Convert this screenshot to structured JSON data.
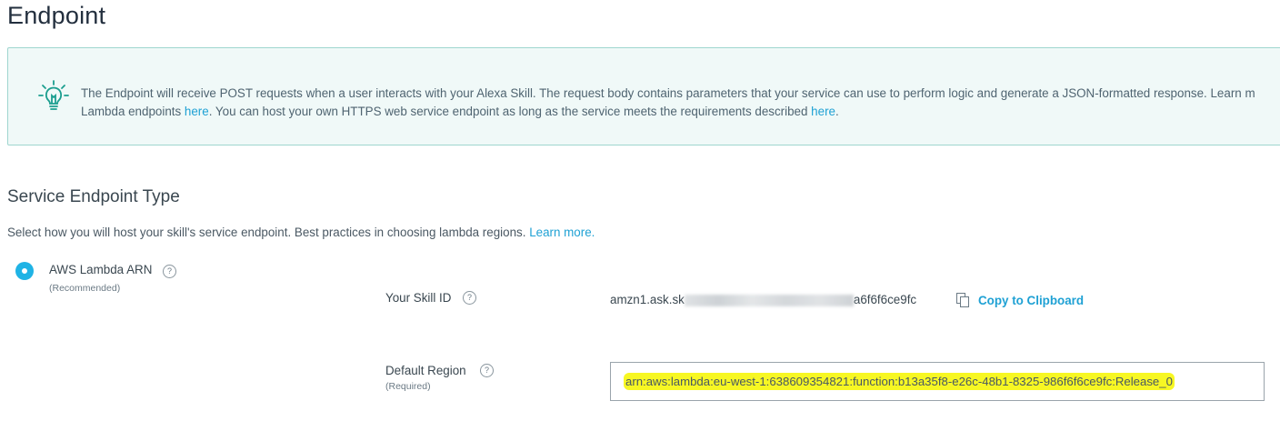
{
  "page": {
    "title": "Endpoint"
  },
  "banner": {
    "line1_text": "The Endpoint will receive POST requests when a user interacts with your Alexa Skill. The request body contains parameters that your service can use to perform logic and generate a JSON-formatted response. Learn m",
    "line2_prefix": "Lambda endpoints ",
    "line2_link1": "here",
    "line2_middle": ". You can host your own HTTPS web service endpoint as long as the service meets the requirements described ",
    "line2_link2": "here",
    "line2_suffix": "."
  },
  "section": {
    "title": "Service Endpoint Type",
    "description": "Select how you will host your skill's service endpoint. Best practices in choosing lambda regions.",
    "learn_more": "Learn more."
  },
  "endpoint_option": {
    "label": "AWS Lambda ARN",
    "sublabel": "(Recommended)",
    "help": "?"
  },
  "skill_id": {
    "label": "Your Skill ID",
    "help": "?",
    "value_prefix": "amzn1.ask.sk",
    "value_suffix": "a6f6f6ce9fc",
    "copy_label": "Copy to Clipboard"
  },
  "default_region": {
    "label": "Default Region",
    "sublabel": "(Required)",
    "help": "?",
    "value": "arn:aws:lambda:eu-west-1:638609354821:function:b13a35f8-e26c-48b1-8325-986f6f6ce9fc:Release_0",
    "highlight_color": "#f7f723"
  },
  "colors": {
    "accent": "#1fa1d4",
    "radio": "#1fb3e5",
    "banner_bg": "#f0f9f8",
    "banner_border": "#9fd6cf"
  }
}
